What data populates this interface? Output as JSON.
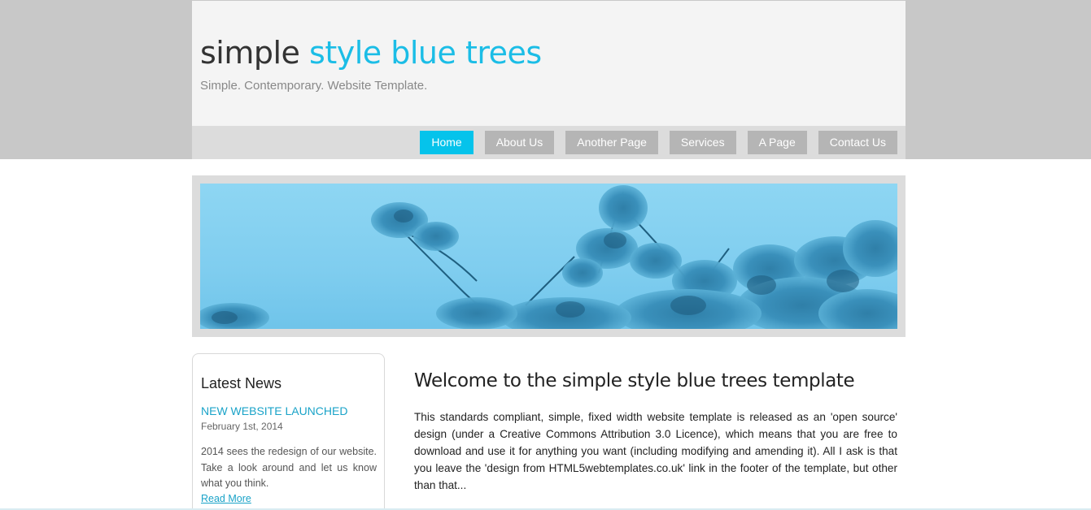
{
  "site": {
    "title_part1": "simple",
    "title_part2": "style blue trees",
    "tagline": "Simple. Contemporary. Website Template."
  },
  "menu": [
    {
      "label": "Home",
      "active": true
    },
    {
      "label": "About Us",
      "active": false
    },
    {
      "label": "Another Page",
      "active": false
    },
    {
      "label": "Services",
      "active": false
    },
    {
      "label": "A Page",
      "active": false
    },
    {
      "label": "Contact Us",
      "active": false
    }
  ],
  "sidebar": {
    "heading": "Latest News",
    "news_title": "NEW WEBSITE LAUNCHED",
    "news_date": "February 1st, 2014",
    "news_text": "2014 sees the redesign of our website. Take a look around and let us know what you think.",
    "read_more": "Read More"
  },
  "main": {
    "title": "Welcome to the simple style blue trees template",
    "text": "This standards compliant, simple, fixed width website template is released as an 'open source' design (under a Creative Commons Attribution 3.0 Licence), which means that you are free to download and use it for anything you want (including modifying and amending it). All I ask is that you leave the 'design from HTML5webtemplates.co.uk' link in the footer of the template, but other than that..."
  },
  "colors": {
    "accent": "#1bbde6",
    "menu_active": "#05c3eb",
    "menu_inactive": "#b5b5b5",
    "link": "#1aa3c8"
  }
}
